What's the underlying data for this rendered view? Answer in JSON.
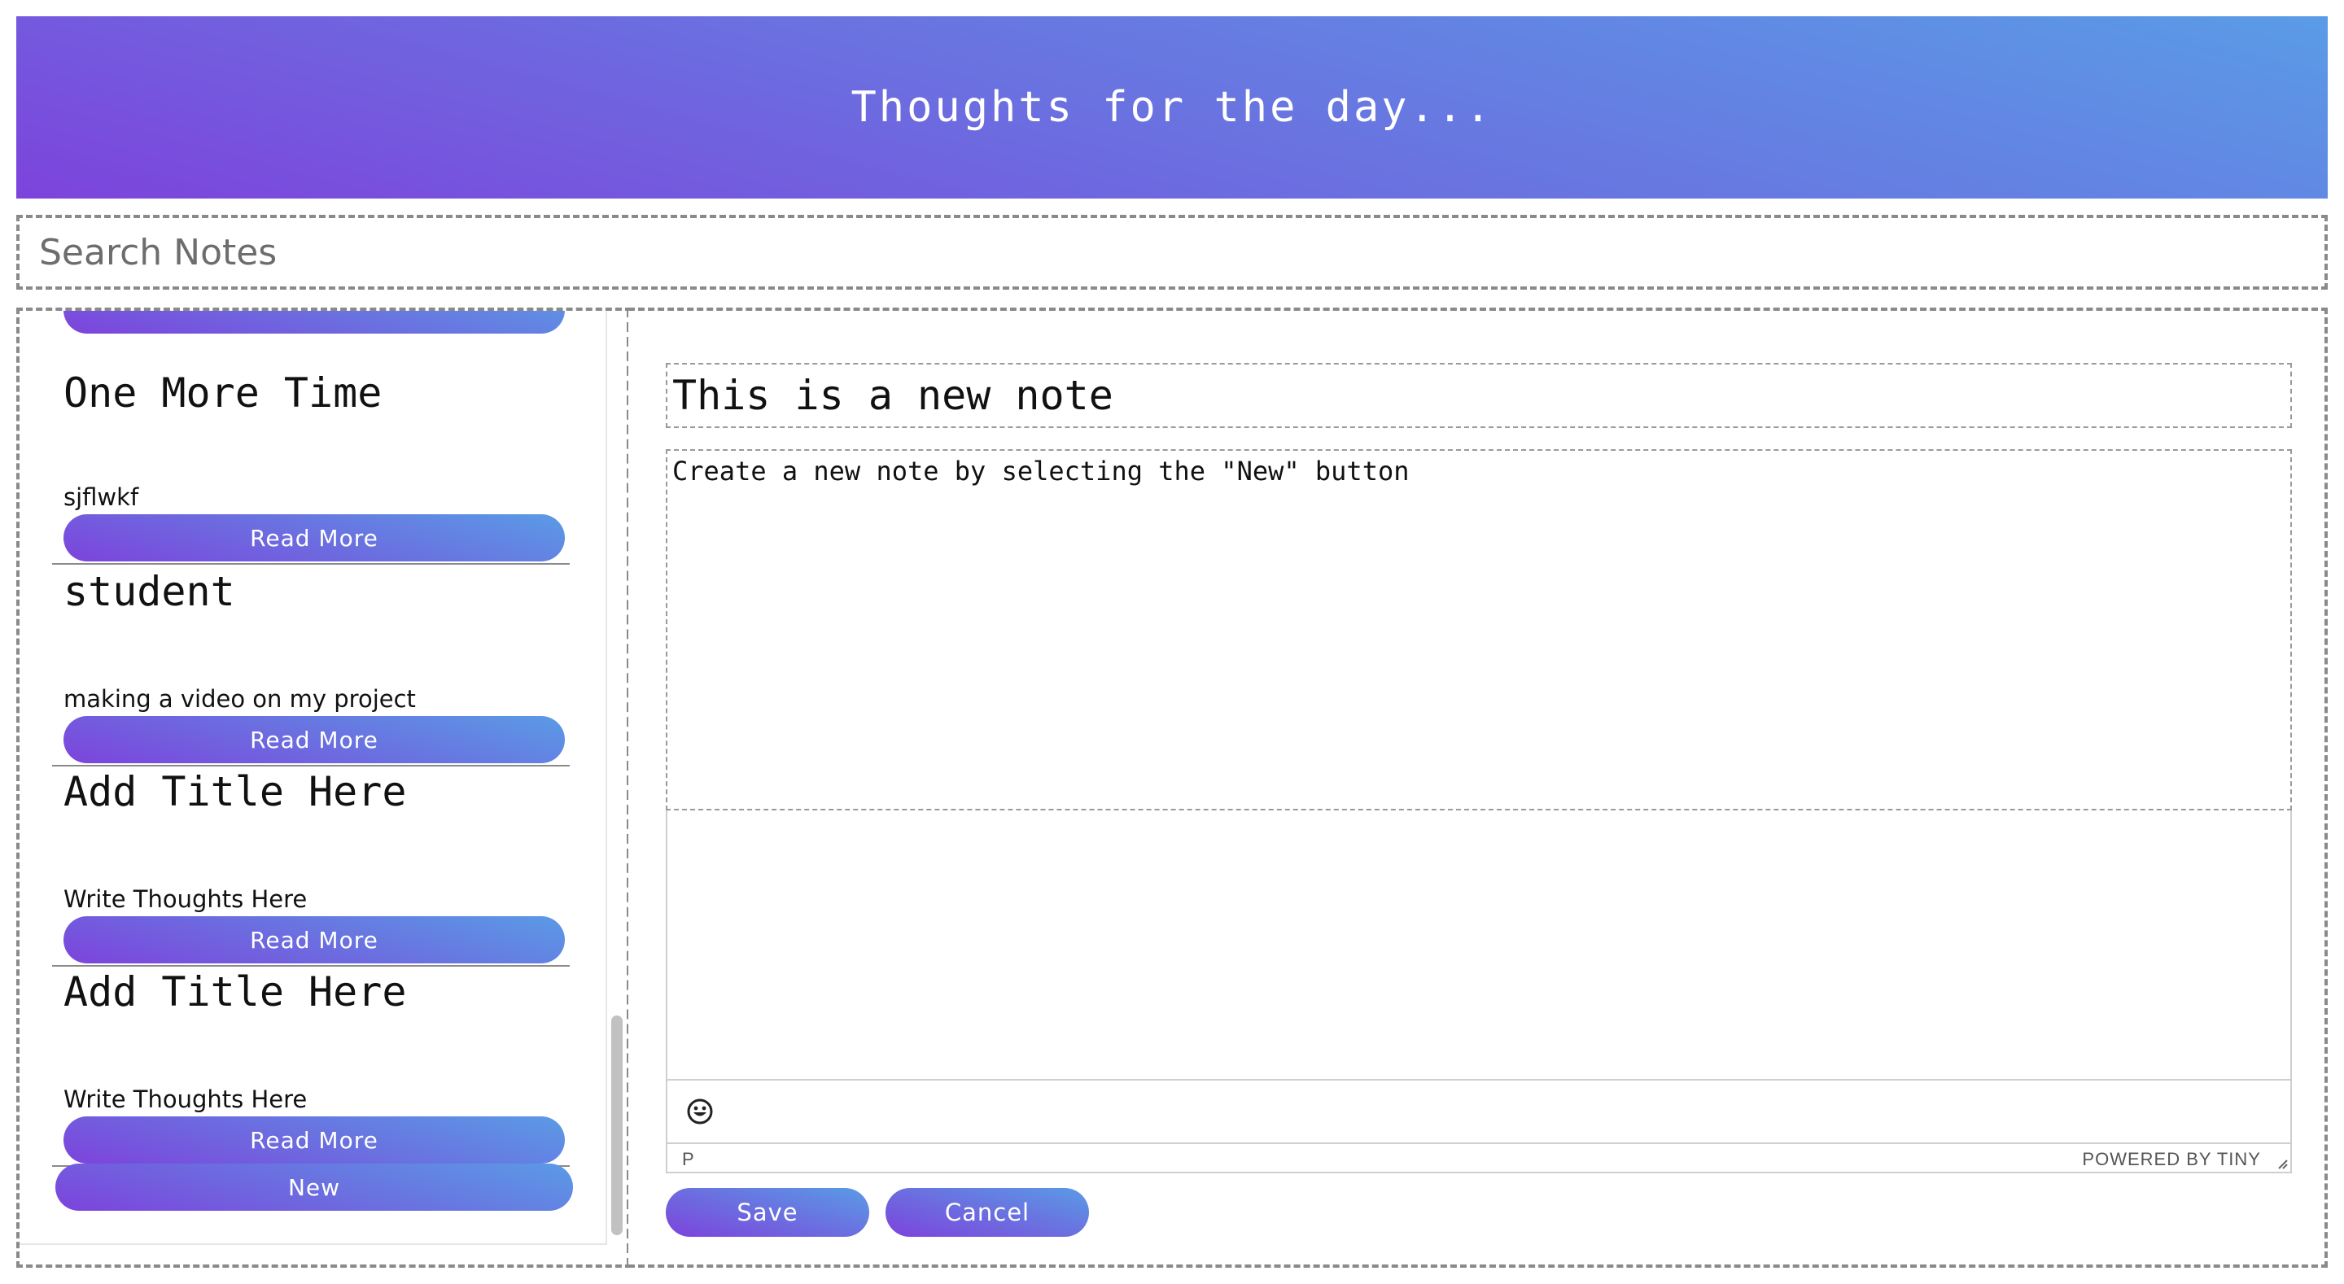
{
  "header": {
    "title": "Thoughts for the day..."
  },
  "search": {
    "placeholder": "Search Notes",
    "value": ""
  },
  "sidebar": {
    "notes": [
      {
        "title": "One More Time",
        "body": "sjflwkf",
        "button_label": "Read More"
      },
      {
        "title": "student",
        "body": "making a video on my project",
        "button_label": "Read More"
      },
      {
        "title": "Add Title Here",
        "body": "Write Thoughts  Here",
        "button_label": "Read More"
      },
      {
        "title": "Add Title Here",
        "body": "Write Thoughts  Here",
        "button_label": "Read More"
      }
    ],
    "new_button_label": "New"
  },
  "editor": {
    "title_value": "This is a new note",
    "body_value": "Create a new note by selecting the \"New\" button",
    "status_path": "P",
    "powered_by": "POWERED BY TINY",
    "save_label": "Save",
    "cancel_label": "Cancel"
  },
  "colors": {
    "gradient_start": "#7d43dc",
    "gradient_end": "#5a9be6",
    "border_dashed": "#8a8a8a"
  }
}
